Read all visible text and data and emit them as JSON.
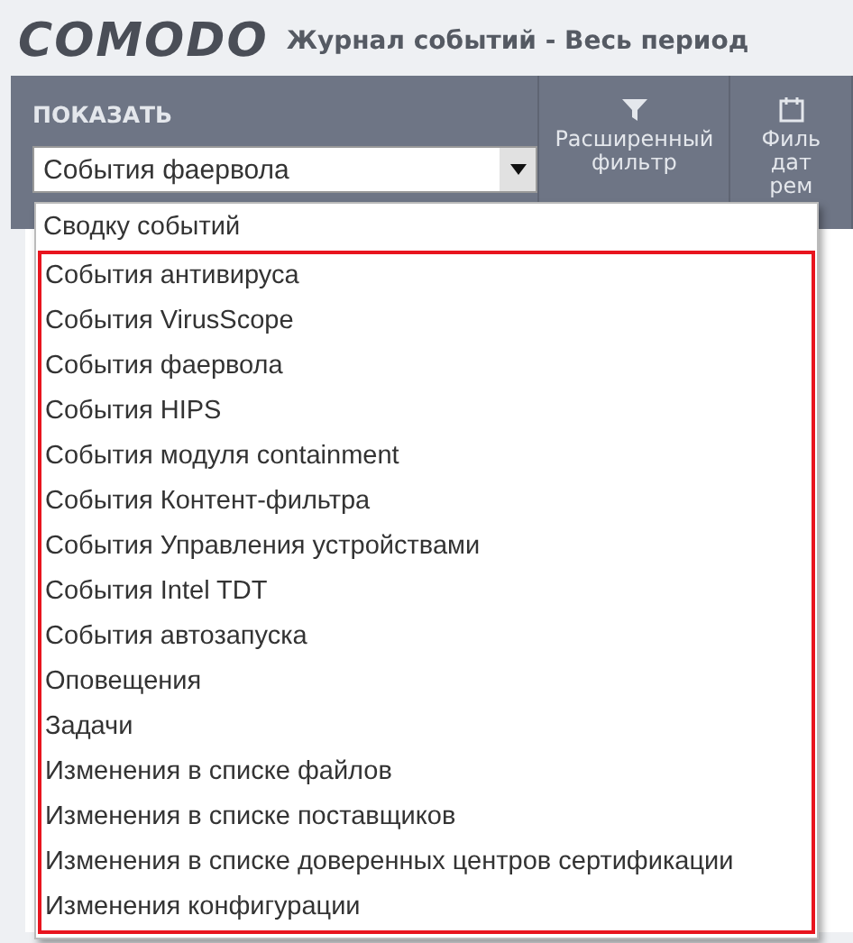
{
  "header": {
    "logo": "COMODO",
    "title": "Журнал событий - Весь период"
  },
  "toolbar": {
    "show_label": "ПОКАЗАТЬ",
    "select_value": "События фаервола",
    "columns": [
      {
        "kind": "filter",
        "lines": [
          "Расширенный",
          "фильтр"
        ]
      },
      {
        "kind": "calendar",
        "lines": [
          "Филь",
          "дат",
          "рем"
        ]
      }
    ]
  },
  "dropdown": {
    "items": [
      {
        "label": "Сводку событий",
        "framed": false
      },
      {
        "label": "События антивируса",
        "framed": true
      },
      {
        "label": "События VirusScope",
        "framed": true
      },
      {
        "label": "События фаервола",
        "framed": true
      },
      {
        "label": "События HIPS",
        "framed": true
      },
      {
        "label": "События модуля containment",
        "framed": true
      },
      {
        "label": "События Контент-фильтра",
        "framed": true
      },
      {
        "label": "События Управления устройствами",
        "framed": true
      },
      {
        "label": "События Intel TDT",
        "framed": true
      },
      {
        "label": "События автозапуска",
        "framed": true
      },
      {
        "label": "Оповещения",
        "framed": true
      },
      {
        "label": "Задачи",
        "framed": true
      },
      {
        "label": "Изменения в списке файлов",
        "framed": true
      },
      {
        "label": "Изменения в списке поставщиков",
        "framed": true
      },
      {
        "label": "Изменения в списке доверенных центров сертификации",
        "framed": true
      },
      {
        "label": "Изменения конфигурации",
        "framed": true
      }
    ]
  }
}
